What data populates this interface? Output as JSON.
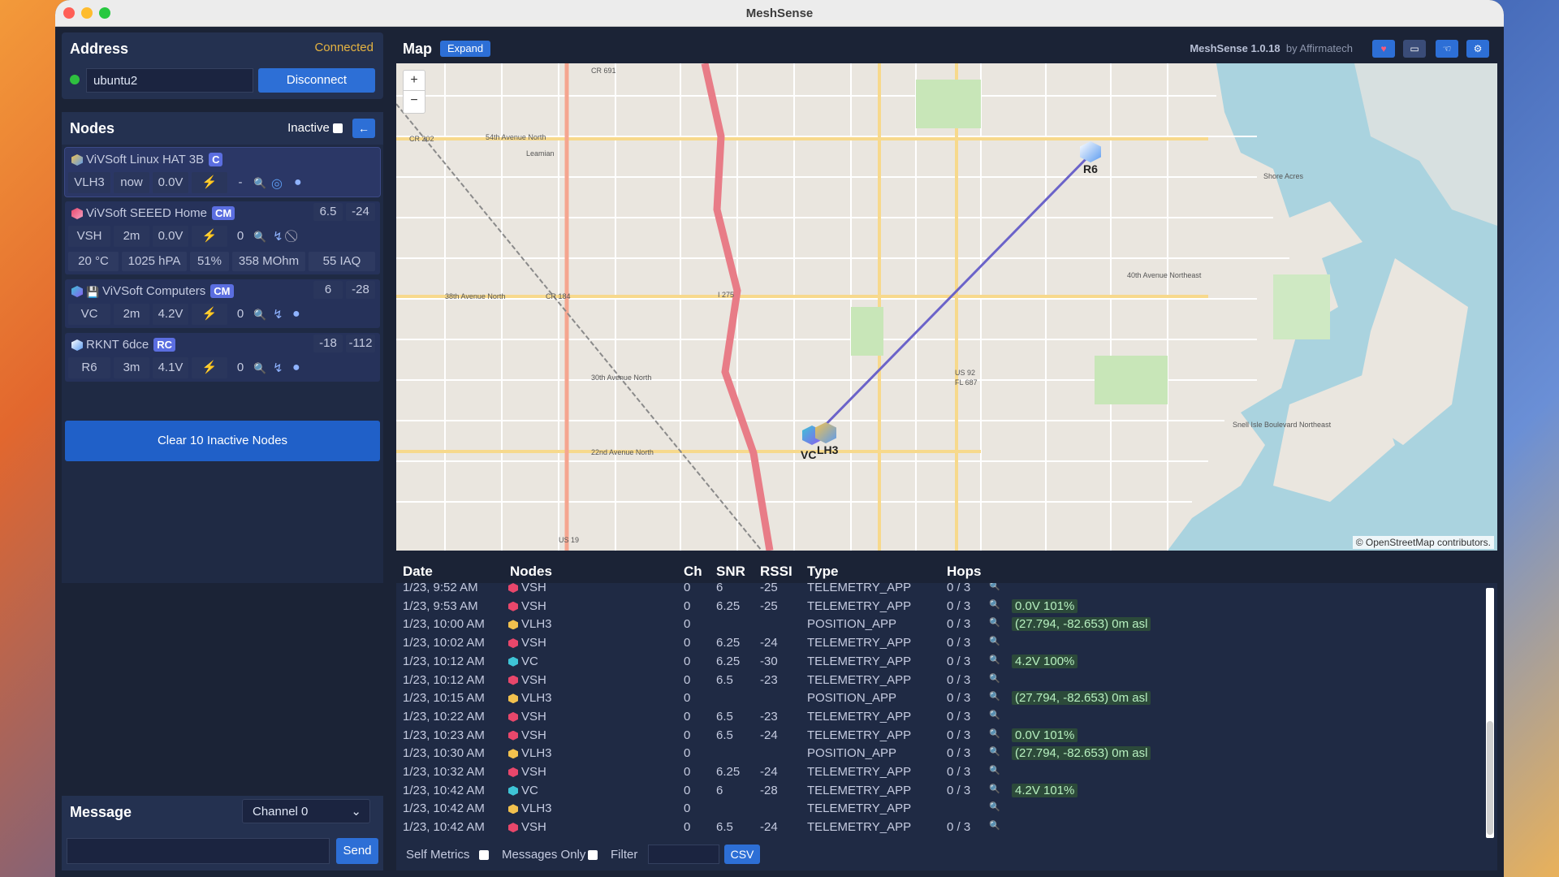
{
  "window": {
    "title": "MeshSense"
  },
  "address": {
    "title": "Address",
    "status": "Connected",
    "host": "ubuntu2",
    "disconnect": "Disconnect"
  },
  "nodes": {
    "title": "Nodes",
    "inactive_label": "Inactive",
    "back_icon": "arrow-left-icon",
    "items": [
      {
        "name": "ViVSoft Linux HAT 3B",
        "badge": "C",
        "snr": "",
        "rssi": "",
        "short": "VLH3",
        "age": "now",
        "voltage": "0.0V",
        "hops": "-"
      },
      {
        "name": "ViVSoft SEEED Home",
        "badge": "CM",
        "snr": "6.5",
        "rssi": "-24",
        "short": "VSH",
        "age": "2m",
        "voltage": "0.0V",
        "hops": "0",
        "env": [
          "20 °C",
          "1025 hPA",
          "51%",
          "358 MOhm",
          "55 IAQ"
        ]
      },
      {
        "name": "ViVSoft Computers",
        "badge": "CM",
        "snr": "6",
        "rssi": "-28",
        "short": "VC",
        "age": "2m",
        "voltage": "4.2V",
        "hops": "0"
      },
      {
        "name": "RKNT 6dce",
        "badge": "RC",
        "snr": "-18",
        "rssi": "-112",
        "short": "R6",
        "age": "3m",
        "voltage": "4.1V",
        "hops": "0"
      }
    ],
    "clear_button": "Clear 10 Inactive Nodes"
  },
  "message": {
    "title": "Message",
    "channel": "Channel 0",
    "send": "Send",
    "input_value": ""
  },
  "map": {
    "title": "Map",
    "expand": "Expand",
    "version": "MeshSense 1.0.18",
    "by": "by Affirmatech",
    "attribution": "© OpenStreetMap contributors.",
    "zoom_in": "+",
    "zoom_out": "−",
    "labels": [
      "CR 691",
      "54th Avenue North",
      "Leamian",
      "CR 202",
      "38th Avenue North",
      "CR 184",
      "I 275",
      "30th Avenue North",
      "22nd Avenue North",
      "US 19",
      "US 92",
      "FL 687",
      "Shore Acres",
      "40th Avenue Northeast",
      "Snell Isle Boulevard Northeast"
    ],
    "markers": [
      {
        "label": "R6"
      },
      {
        "label": "VC"
      },
      {
        "label": "LH3"
      }
    ]
  },
  "log": {
    "columns": [
      "Date",
      "Nodes",
      "Ch",
      "SNR",
      "RSSI",
      "Type",
      "Hops"
    ],
    "rows": [
      {
        "date": "1/23, 9:52 AM",
        "node": "VSH",
        "ch": "0",
        "snr": "6",
        "rssi": "-25",
        "type": "TELEMETRY_APP",
        "hops": "0 / 3",
        "info": "",
        "color": "#e8476b"
      },
      {
        "date": "1/23, 9:53 AM",
        "node": "VSH",
        "ch": "0",
        "snr": "6.25",
        "rssi": "-25",
        "type": "TELEMETRY_APP",
        "hops": "0 / 3",
        "info": "0.0V 101%",
        "color": "#e8476b"
      },
      {
        "date": "1/23, 10:00 AM",
        "node": "VLH3",
        "ch": "0",
        "snr": "",
        "rssi": "",
        "type": "POSITION_APP",
        "hops": "0 / 3",
        "info": "(27.794, -82.653) 0m asl",
        "color": "#f2c14e"
      },
      {
        "date": "1/23, 10:02 AM",
        "node": "VSH",
        "ch": "0",
        "snr": "6.25",
        "rssi": "-24",
        "type": "TELEMETRY_APP",
        "hops": "0 / 3",
        "info": "",
        "color": "#e8476b"
      },
      {
        "date": "1/23, 10:12 AM",
        "node": "VC",
        "ch": "0",
        "snr": "6.25",
        "rssi": "-30",
        "type": "TELEMETRY_APP",
        "hops": "0 / 3",
        "info": "4.2V 100%",
        "color": "#3ec4d6"
      },
      {
        "date": "1/23, 10:12 AM",
        "node": "VSH",
        "ch": "0",
        "snr": "6.5",
        "rssi": "-23",
        "type": "TELEMETRY_APP",
        "hops": "0 / 3",
        "info": "",
        "color": "#e8476b"
      },
      {
        "date": "1/23, 10:15 AM",
        "node": "VLH3",
        "ch": "0",
        "snr": "",
        "rssi": "",
        "type": "POSITION_APP",
        "hops": "0 / 3",
        "info": "(27.794, -82.653) 0m asl",
        "color": "#f2c14e"
      },
      {
        "date": "1/23, 10:22 AM",
        "node": "VSH",
        "ch": "0",
        "snr": "6.5",
        "rssi": "-23",
        "type": "TELEMETRY_APP",
        "hops": "0 / 3",
        "info": "",
        "color": "#e8476b"
      },
      {
        "date": "1/23, 10:23 AM",
        "node": "VSH",
        "ch": "0",
        "snr": "6.5",
        "rssi": "-24",
        "type": "TELEMETRY_APP",
        "hops": "0 / 3",
        "info": "0.0V 101%",
        "color": "#e8476b"
      },
      {
        "date": "1/23, 10:30 AM",
        "node": "VLH3",
        "ch": "0",
        "snr": "",
        "rssi": "",
        "type": "POSITION_APP",
        "hops": "0 / 3",
        "info": "(27.794, -82.653) 0m asl",
        "color": "#f2c14e"
      },
      {
        "date": "1/23, 10:32 AM",
        "node": "VSH",
        "ch": "0",
        "snr": "6.25",
        "rssi": "-24",
        "type": "TELEMETRY_APP",
        "hops": "0 / 3",
        "info": "",
        "color": "#e8476b"
      },
      {
        "date": "1/23, 10:42 AM",
        "node": "VC",
        "ch": "0",
        "snr": "6",
        "rssi": "-28",
        "type": "TELEMETRY_APP",
        "hops": "0 / 3",
        "info": "4.2V 101%",
        "color": "#3ec4d6"
      },
      {
        "date": "1/23, 10:42 AM",
        "node": "VLH3",
        "ch": "0",
        "snr": "",
        "rssi": "",
        "type": "TELEMETRY_APP",
        "hops": "",
        "info": "",
        "color": "#f2c14e"
      },
      {
        "date": "1/23, 10:42 AM",
        "node": "VSH",
        "ch": "0",
        "snr": "6.5",
        "rssi": "-24",
        "type": "TELEMETRY_APP",
        "hops": "0 / 3",
        "info": "",
        "color": "#e8476b"
      }
    ],
    "footer": {
      "self_metrics": "Self Metrics",
      "messages_only": "Messages Only",
      "filter": "Filter",
      "csv": "CSV"
    }
  },
  "colors": {
    "accent": "#2d6fd6",
    "connected": "#e5b341",
    "panel": "#243150"
  }
}
